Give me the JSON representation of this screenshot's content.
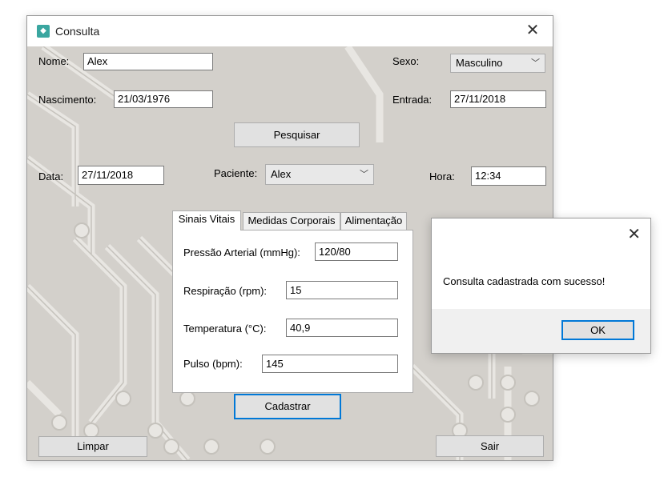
{
  "window": {
    "title": "Consulta",
    "icon": "app-icon"
  },
  "form": {
    "nome_label": "Nome:",
    "nome_value": "Alex",
    "sexo_label": "Sexo:",
    "sexo_value": "Masculino",
    "nascimento_label": "Nascimento:",
    "nascimento_value": "21/03/1976",
    "entrada_label": "Entrada:",
    "entrada_value": "27/11/2018",
    "pesquisar_button": "Pesquisar",
    "data_label": "Data:",
    "data_value": "27/11/2018",
    "paciente_label": "Paciente:",
    "paciente_value": "Alex",
    "hora_label": "Hora:",
    "hora_value": "12:34"
  },
  "tabs": [
    {
      "label": "Sinais Vitais",
      "selected": true
    },
    {
      "label": "Medidas Corporais",
      "selected": false
    },
    {
      "label": "Alimentação",
      "selected": false
    }
  ],
  "vitals": {
    "pressao_label": "Pressão Arterial (mmHg):",
    "pressao_value": "120/80",
    "respiracao_label": "Respiração (rpm):",
    "respiracao_value": "15",
    "temperatura_label": "Temperatura (°C):",
    "temperatura_value": "40,9",
    "pulso_label": "Pulso (bpm):",
    "pulso_value": "145"
  },
  "buttons": {
    "cadastrar": "Cadastrar",
    "limpar": "Limpar",
    "sair": "Sair"
  },
  "dialog": {
    "message": "Consulta cadastrada com sucesso!",
    "ok_button": "OK"
  },
  "colors": {
    "background": "#d3d0cb",
    "accent": "#0078d7",
    "app_icon": "#3aa6a0"
  }
}
